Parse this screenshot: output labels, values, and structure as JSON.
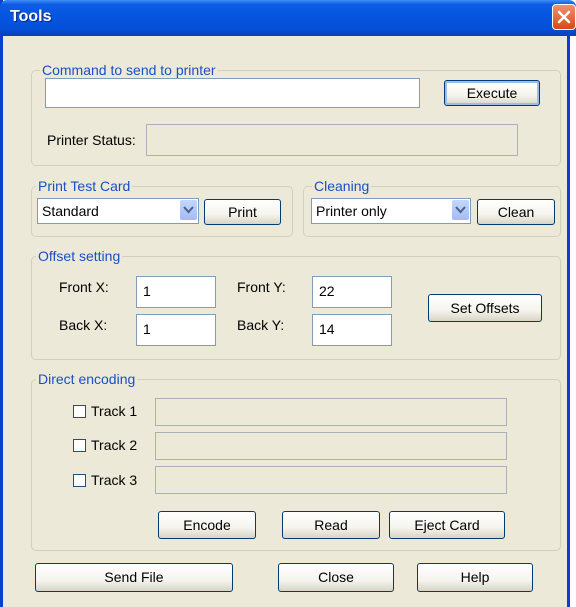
{
  "window": {
    "title": "Tools"
  },
  "command": {
    "legend": "Command to send to printer",
    "input_value": "",
    "execute_label": "Execute",
    "status_label": "Printer Status:",
    "status_value": ""
  },
  "test_card": {
    "legend": "Print Test Card",
    "selected": "Standard",
    "print_label": "Print"
  },
  "cleaning": {
    "legend": "Cleaning",
    "selected": "Printer only",
    "clean_label": "Clean"
  },
  "offsets": {
    "legend": "Offset setting",
    "front_x_label": "Front X:",
    "front_x_value": "1",
    "front_y_label": "Front Y:",
    "front_y_value": "22",
    "back_x_label": "Back X:",
    "back_x_value": "1",
    "back_y_label": "Back Y:",
    "back_y_value": "14",
    "set_label": "Set Offsets"
  },
  "encoding": {
    "legend": "Direct encoding",
    "tracks": [
      {
        "label": "Track 1",
        "checked": false,
        "value": ""
      },
      {
        "label": "Track 2",
        "checked": false,
        "value": ""
      },
      {
        "label": "Track 3",
        "checked": false,
        "value": ""
      }
    ],
    "encode_label": "Encode",
    "read_label": "Read",
    "eject_label": "Eject Card"
  },
  "footer": {
    "send_file_label": "Send File",
    "close_label": "Close",
    "help_label": "Help"
  }
}
